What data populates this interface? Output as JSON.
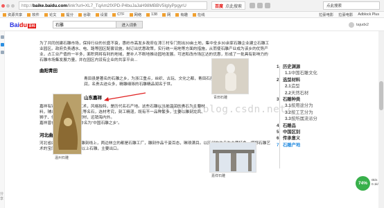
{
  "browser": {
    "url_proto": "http://",
    "url_host": "baike.baidu.com",
    "url_rest": "/link?url=XL7_TqAm2fXPD-P4buJaJaH98MBBV5IgIyPpgyrU",
    "search_engine": "百度",
    "search_pill_text": "点此搜索",
    "tab_title": "点此搜索"
  },
  "bookmarks": [
    "资源共享",
    "软件",
    "论文",
    "提分",
    "谷歌",
    "设置",
    "CTF",
    "网络",
    "138",
    "网",
    "有趣",
    "在线"
  ],
  "bookmarks_right": [
    "拉豪电影",
    "拉豪电影",
    "Adblock Plus"
  ],
  "header": {
    "logo_a": "Bai",
    "logo_b": "du",
    "logo_badge": "百科",
    "search_value": "石雕",
    "search_btn": "进入词条",
    "username": "tajudx2"
  },
  "content": {
    "p1": "为了共同创建石雕市场，保持行业的长盛不衰，惠岭市高发乡政府在漳三村专门划出30亩土地，集中全乡30余家石雕企业建立石雕工业园区。政府负责通水、电、路等园区配套设施，制订出优惠政策，实行统一用地等方面的措施，从而使石雕产业成为该乡的优势产业，占工业产值的一半多，面积两将有利的地域，是补人不断地推动园地发展。可进和改市场区达的优惠，形成了一批具有影响力的石雕市场集发展力量，并在园区内设有企业的共享平台...",
    "h_quyang": "曲阳青田",
    "p_quyang": "青田县是著名的石雕之乡，为浙江重点，丝织、古玩、文化之都，青田石质地温润，名贵古迹众多，精雕细琢的石雕精品闻名于世。",
    "quyang_highlight": "石雕之乡",
    "h_shandong": "山东嘉祥",
    "p_shandong": "嘉祥有别具匠心的石雕艺术，风格独特，是历代名石产地。这些石雕以当地温润的青石为主要材料，辅以大理石、汉白玉等名石，选材考究，刻工精湛，既有不一品种繁多，主要以雕刻龙凤、狮子、佛像等为特色的题材，远销海内外。",
    "p_shandong2": "嘉祥曾在1996年被国家命名为“中国石雕之乡”。",
    "h_hebei": "河北曲阳",
    "p_hebei": "河北省曲阳县4公里长的雕刻线上，两边林立的都是石雕工厂，雕刻作品千姿百态，琳琅满目。以历代的作品为主要特色，堪称石雕艺术的宝库，以至100万件以上石雕，主要出口。",
    "img1_cap": "温州石雕",
    "img2_cap": "青田石雕",
    "img3_cap": "嘉祥石雕",
    "watermark": "http://blog.csdn.net/"
  },
  "toc": [
    {
      "n": "1",
      "t": "历史渊源",
      "main": true
    },
    {
      "n": "1.1",
      "t": "中国石雕文化",
      "main": false
    },
    {
      "n": "2",
      "t": "选型材料",
      "main": true
    },
    {
      "n": "2.1",
      "t": "造型",
      "main": false
    },
    {
      "n": "2.2",
      "t": "天然石材",
      "main": false
    },
    {
      "n": "3",
      "t": "石雕种类",
      "main": true
    },
    {
      "n": "3.1",
      "t": "按用途分为",
      "main": false
    },
    {
      "n": "3.2",
      "t": "按工艺分为",
      "main": false
    },
    {
      "n": "3.3",
      "t": "按所属流派分",
      "main": false
    },
    {
      "n": "4",
      "t": "石雕品",
      "main": true
    },
    {
      "n": "5",
      "t": "中国区别",
      "main": true
    },
    {
      "n": "6",
      "t": "传承意义",
      "main": true
    },
    {
      "n": "7",
      "t": "石雕产地",
      "main": true,
      "active": true
    }
  ],
  "status": {
    "percent": "74%",
    "up": "0k/s",
    "down": "0.1k/s"
  },
  "left_strip_label": "分享"
}
